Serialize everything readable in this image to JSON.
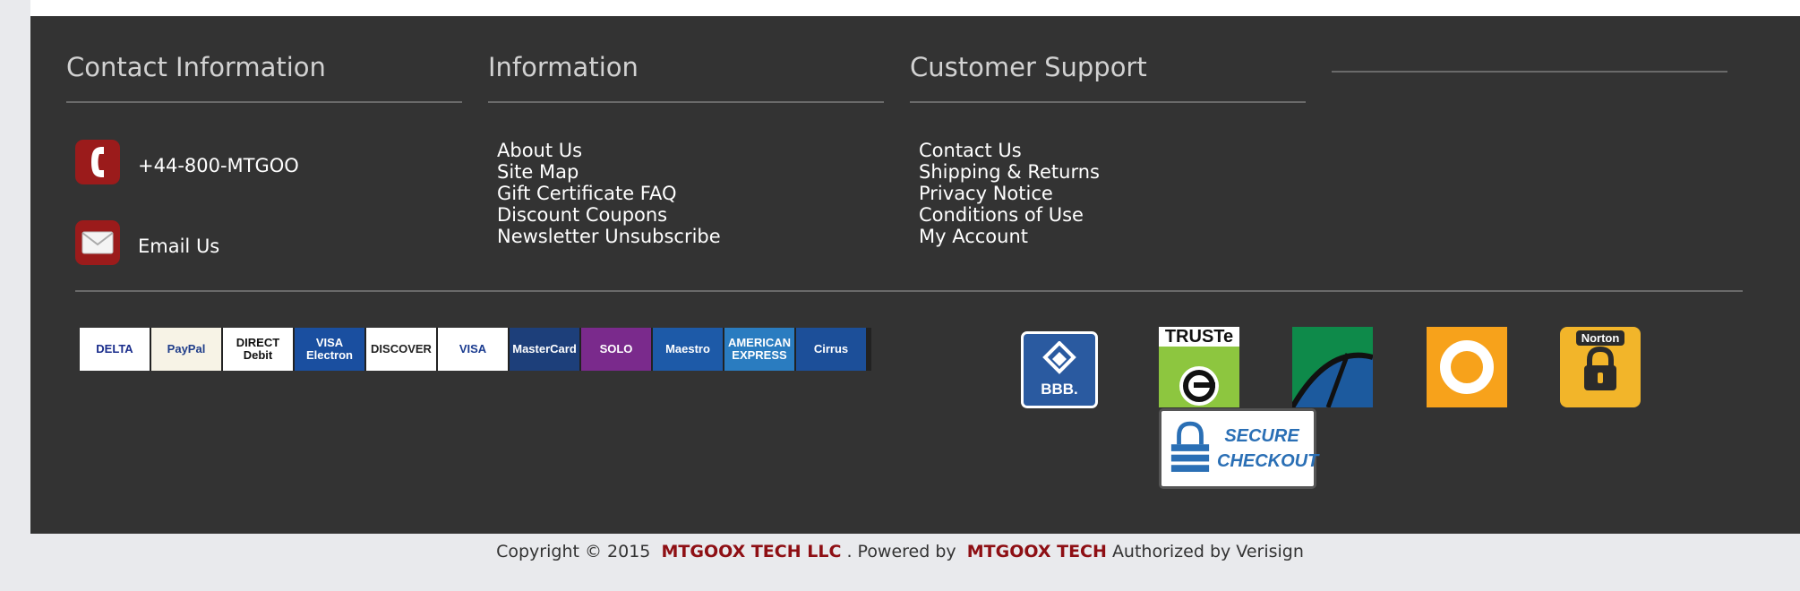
{
  "columns": {
    "contact": {
      "title": "Contact Information",
      "phone": "+44-800-MTGOO",
      "email": "Email Us"
    },
    "information": {
      "title": "Information",
      "links": [
        "About Us",
        "Site Map",
        "Gift Certificate FAQ",
        "Discount Coupons",
        "Newsletter Unsubscribe"
      ]
    },
    "support": {
      "title": "Customer Support",
      "links": [
        "Contact Us",
        "Shipping & Returns",
        "Privacy Notice",
        "Conditions of Use",
        "My Account"
      ]
    },
    "fourth": {
      "title": ""
    }
  },
  "payment_cards": [
    {
      "name": "Delta",
      "label": "DELTA",
      "bg": "#ffffff",
      "fg": "#1a2d8c"
    },
    {
      "name": "PayPal",
      "label": "PayPal",
      "bg": "#f7f3e6",
      "fg": "#1f3d8a"
    },
    {
      "name": "Direct Debit",
      "label": "DIRECT Debit",
      "bg": "#ffffff",
      "fg": "#111111"
    },
    {
      "name": "Visa Electron",
      "label": "VISA Electron",
      "bg": "#1a4fa0",
      "fg": "#ffffff"
    },
    {
      "name": "Discover",
      "label": "DISCOVER",
      "bg": "#ffffff",
      "fg": "#222222"
    },
    {
      "name": "Visa",
      "label": "VISA",
      "bg": "#ffffff",
      "fg": "#1a3b8f"
    },
    {
      "name": "MasterCard",
      "label": "MasterCard",
      "bg": "#1d3f7a",
      "fg": "#ffffff"
    },
    {
      "name": "Solo",
      "label": "SOLO",
      "bg": "#7a2a8c",
      "fg": "#ffffff"
    },
    {
      "name": "Maestro",
      "label": "Maestro",
      "bg": "#1d5aa8",
      "fg": "#ffffff"
    },
    {
      "name": "American Express",
      "label": "AMERICAN EXPRESS",
      "bg": "#2a7cc0",
      "fg": "#ffffff"
    },
    {
      "name": "Cirrus",
      "label": "Cirrus",
      "bg": "#1c4f99",
      "fg": "#ffffff"
    }
  ],
  "seals": {
    "bbb": "BBB.",
    "truste": "TRUSTe",
    "secure_checkout": "SECURE CHECKOUT",
    "norton": "Norton"
  },
  "copyright": {
    "prefix": "Copyright © 2015",
    "company": "MTGOOX TECH LLC",
    "powered": ". Powered by",
    "brand": "MTGOOX TECH",
    "suffix": "Authorized by Verisign"
  },
  "colors": {
    "footer_bg": "#333333",
    "accent_red": "#9b1b1b",
    "brand_red": "#8e0f14",
    "heading": "#d2d2d2"
  }
}
